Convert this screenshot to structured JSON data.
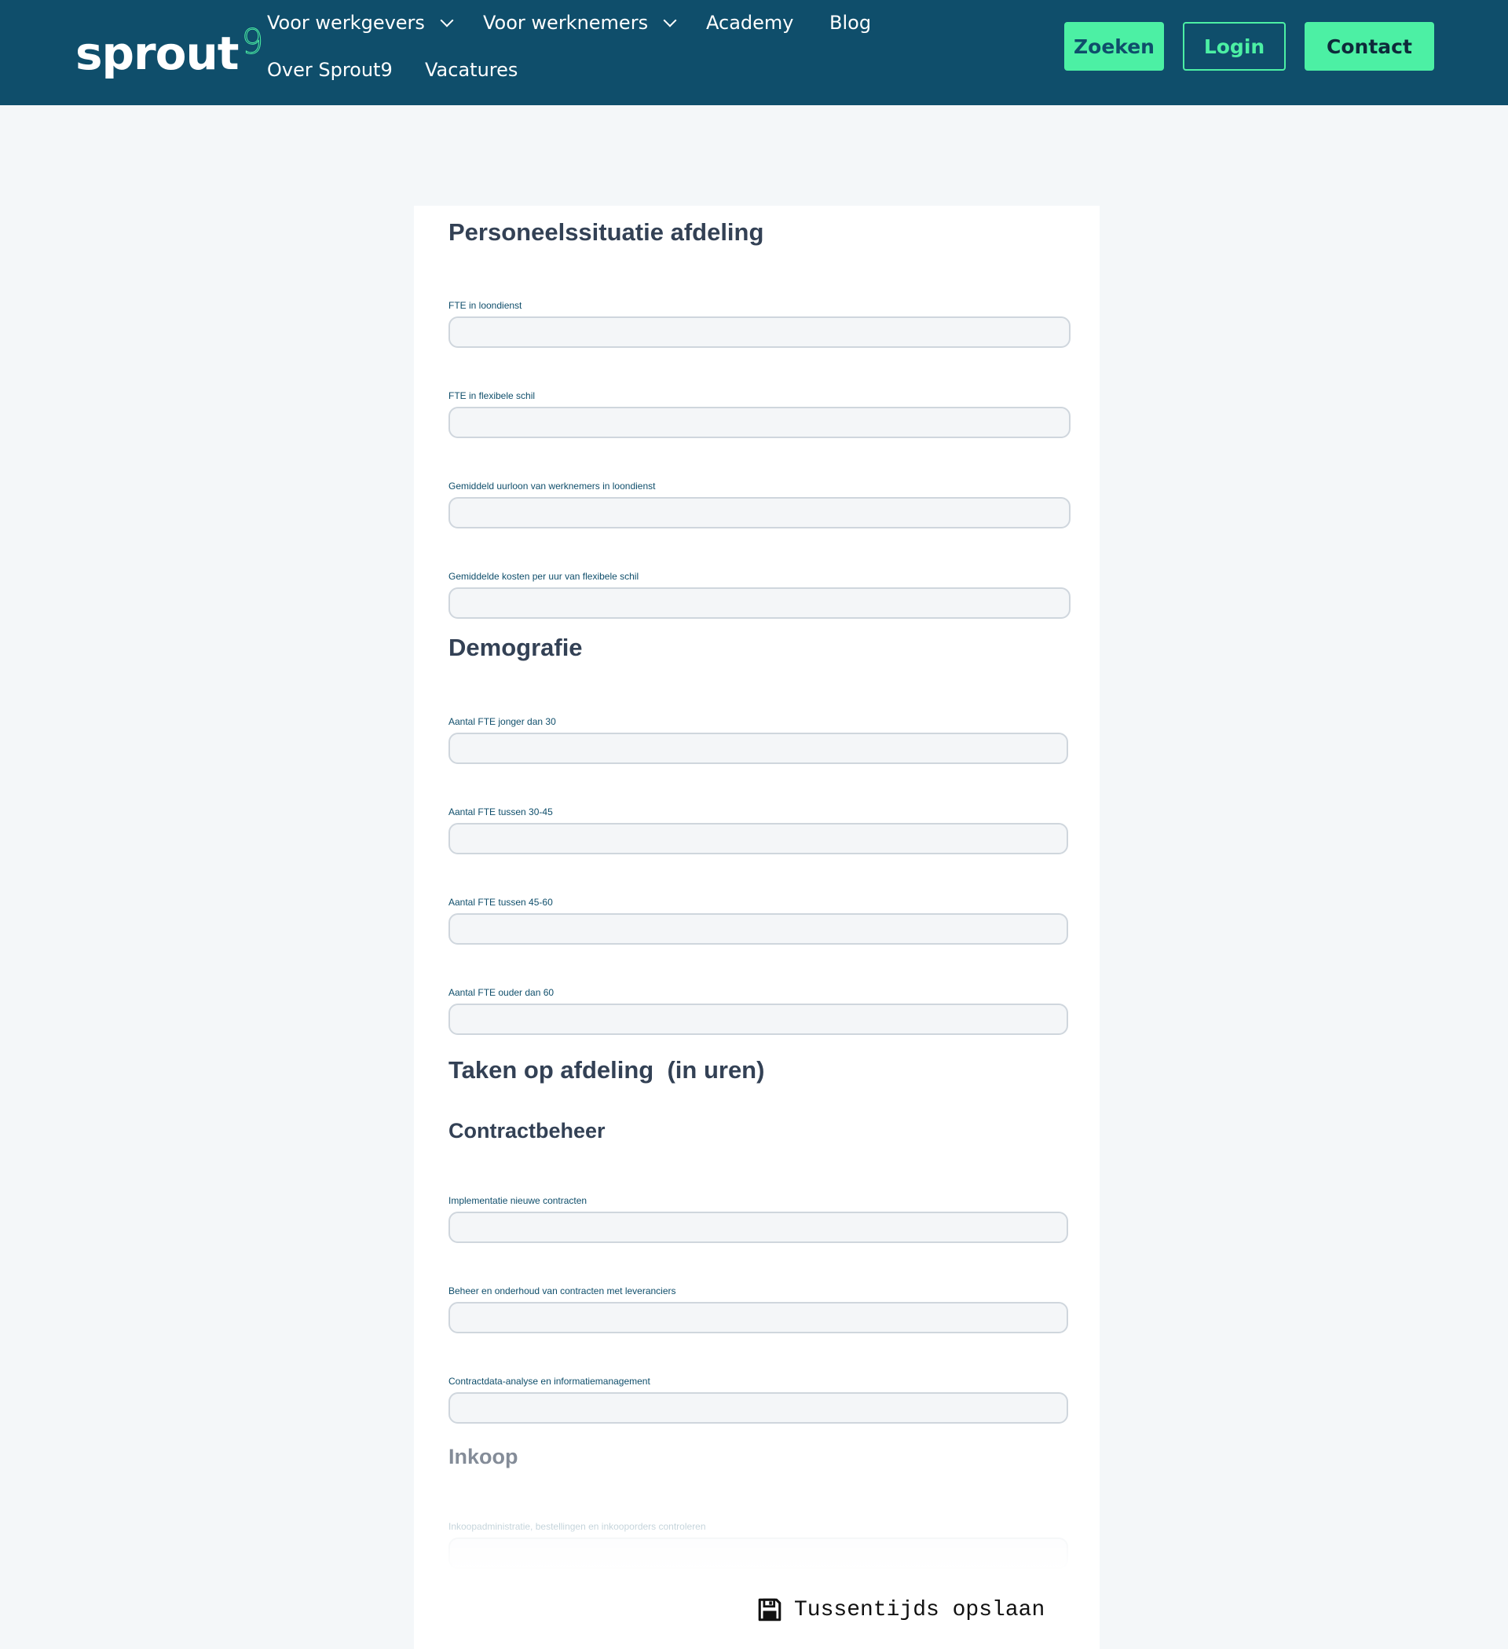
{
  "header": {
    "logo_text": "sprout",
    "logo_mark": "9",
    "nav": [
      {
        "label": "Voor werkgevers",
        "dropdown": true
      },
      {
        "label": "Voor werknemers",
        "dropdown": true
      },
      {
        "label": "Academy",
        "dropdown": false
      },
      {
        "label": "Blog",
        "dropdown": false
      },
      {
        "label": "Over Sprout9",
        "dropdown": false
      },
      {
        "label": "Vacatures",
        "dropdown": false
      }
    ],
    "buttons": {
      "search": "Zoeken",
      "login": "Login",
      "contact": "Contact"
    }
  },
  "form": {
    "sections": {
      "personeel": "Personeelssituatie afdeling",
      "demografie": "Demografie",
      "taken": "Taken op afdeling  (in uren)",
      "contractbeheer": "Contractbeheer",
      "inkoop": "Inkoop"
    },
    "fields": {
      "fte_loondienst": {
        "label": "FTE in loondienst",
        "value": ""
      },
      "fte_flexibel": {
        "label": "FTE in flexibele schil",
        "value": ""
      },
      "uurloon": {
        "label": "Gemiddeld uurloon van werknemers in loondienst",
        "value": ""
      },
      "kosten_flex": {
        "label": "Gemiddelde kosten per uur van flexibele schil",
        "value": ""
      },
      "jonger_30": {
        "label": "Aantal FTE jonger dan 30",
        "value": ""
      },
      "tussen_30_45": {
        "label": "Aantal FTE tussen 30-45",
        "value": ""
      },
      "tussen_45_60": {
        "label": "Aantal FTE tussen 45-60",
        "value": ""
      },
      "ouder_60": {
        "label": "Aantal FTE ouder dan 60",
        "value": ""
      },
      "implementatie": {
        "label": "Implementatie nieuwe contracten",
        "value": ""
      },
      "beheer": {
        "label": "Beheer en onderhoud van contracten met leveranciers",
        "value": ""
      },
      "contractdata": {
        "label": "Contractdata-analyse en informatiemanagement",
        "value": ""
      },
      "inkoopadmin": {
        "label": "Inkoopadministratie, bestellingen en inkooporders controleren",
        "value": ""
      }
    },
    "save_label": "Tussentijds opslaan"
  },
  "icons": {
    "save": "floppy-disk-icon",
    "dropdown": "chevron-down-icon"
  },
  "colors": {
    "header_bg": "#0f4e6b",
    "accent": "#4cf0a4",
    "page_bg": "#f4f7f9"
  }
}
